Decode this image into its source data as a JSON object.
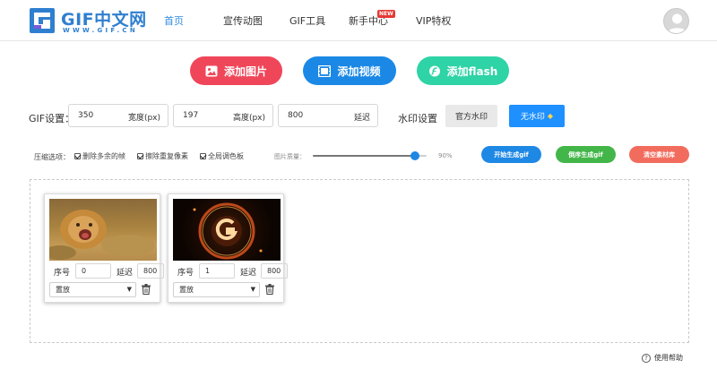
{
  "brand": {
    "title": "GIF中文网",
    "subtitle": "WWW.GIF.CN",
    "accent": "#2f7fd0"
  },
  "nav": {
    "items": [
      {
        "label": "首页",
        "active": true
      },
      {
        "label": "宣传动图"
      },
      {
        "label": "GIF工具"
      },
      {
        "label": "新手中心"
      },
      {
        "label": "VIP特权"
      }
    ],
    "vip_badge": "NEW"
  },
  "add_buttons": {
    "image": "添加图片",
    "video": "添加视频",
    "flash": "添加flash"
  },
  "gif_settings": {
    "label": "GIF设置：",
    "width": {
      "value": "350",
      "unit": "宽度(px)"
    },
    "height": {
      "value": "197",
      "unit": "高度(px)"
    },
    "delay": {
      "value": "800",
      "unit": "延迟"
    }
  },
  "watermark": {
    "label": "水印设置",
    "official": "官方水印",
    "none": "无水印",
    "none_icon": "diamond-icon"
  },
  "compression": {
    "label": "压缩选项：",
    "options": [
      "删除多余的帧",
      "擦除重复像素",
      "全局调色板"
    ],
    "quality_label": "图片质量：",
    "quality_value": "90%",
    "quality_fraction": 0.9
  },
  "actions": {
    "generate": "开始生成gif",
    "reverse": "倒序生成gif",
    "clear": "清空素材库"
  },
  "frames": [
    {
      "seq_label": "序号",
      "seq": "0",
      "delay_label": "延迟",
      "delay": "800",
      "mode": "置放"
    },
    {
      "seq_label": "序号",
      "seq": "1",
      "delay_label": "延迟",
      "delay": "800",
      "mode": "置放"
    }
  ],
  "footer": {
    "help": "使用帮助"
  },
  "colors": {
    "add_image": "#f0465a",
    "add_video": "#1b88e6",
    "add_flash": "#2ed3a6",
    "generate": "#1e88e5",
    "reverse": "#43b649",
    "clear": "#f26c5d"
  }
}
